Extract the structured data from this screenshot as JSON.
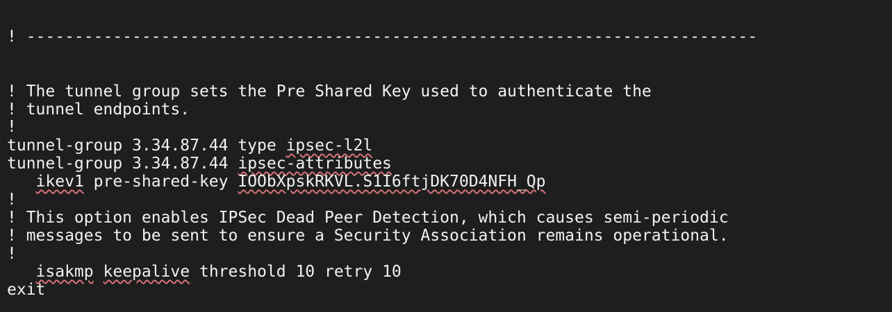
{
  "editor": {
    "lines": {
      "divider": "! ----------------------------------------------------------------------------",
      "comment_1": "! The tunnel group sets the Pre Shared Key used to authenticate the",
      "comment_2": "! tunnel endpoints.",
      "bang_1": "!",
      "tg_type": {
        "prefix": "tunnel-group 3.34.87.44 type ",
        "value": "ipsec-l2l"
      },
      "tg_attr": {
        "prefix": "tunnel-group 3.34.87.44 ",
        "value": "ipsec-attributes"
      },
      "psk": {
        "indent": "   ",
        "keyword": "ikev1",
        "middle": " pre-shared-key ",
        "value": "IOObXpskRKVL.S1I6ftjDK70D4NFH_Qp"
      },
      "bang_2": "!",
      "comment_3": "! This option enables IPSec Dead Peer Detection, which causes semi-periodic",
      "comment_4": "! messages to be sent to ensure a Security Association remains operational.",
      "bang_3": "!",
      "keepalive": {
        "indent": "   ",
        "word1": "isakmp",
        "space": " ",
        "word2": "keepalive",
        "rest": " threshold 10 retry 10"
      },
      "exit": "exit"
    }
  }
}
